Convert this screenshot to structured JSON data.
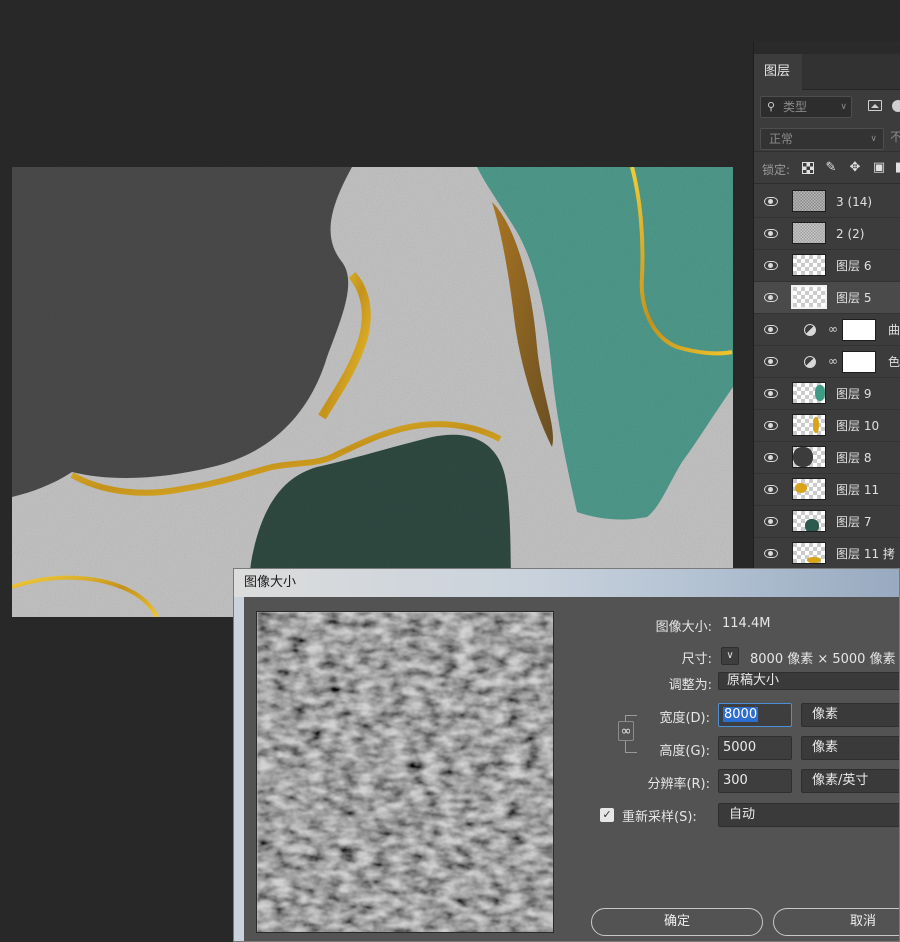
{
  "layers_panel": {
    "tab_label": "图层",
    "filter_placeholder": "类型",
    "blend_mode": "正常",
    "opacity_label": "不",
    "lock_label": "锁定:",
    "icons": {
      "search": "magnifier-icon",
      "lock_pixels": "checkerboard-icon",
      "lock_brush": "brush-icon",
      "lock_move": "move-icon",
      "lock_artboard": "crop-icon",
      "eye": "eye-icon",
      "adjustment": "half-circle-icon",
      "link": "chain-link-icon"
    },
    "layers": [
      {
        "name": "3 (14)",
        "thumb": "texture"
      },
      {
        "name": "2 (2)",
        "thumb": "texture"
      },
      {
        "name": "图层 6",
        "thumb": "transparent"
      },
      {
        "name": "图层 5",
        "thumb": "transparent",
        "selected": true
      },
      {
        "name": "曲",
        "type": "adjustment"
      },
      {
        "name": "色",
        "type": "adjustment"
      },
      {
        "name": "图层 9",
        "thumb": "teal"
      },
      {
        "name": "图层 10",
        "thumb": "gold"
      },
      {
        "name": "图层 8",
        "thumb": "dark"
      },
      {
        "name": "图层 11",
        "thumb": "gold2"
      },
      {
        "name": "图层 7",
        "thumb": "green"
      },
      {
        "name": "图层 11 拷",
        "thumb": "gold3"
      }
    ]
  },
  "dialog": {
    "title": "图像大小",
    "image_size_label": "图像大小:",
    "image_size_value": "114.4M",
    "dimensions_label": "尺寸:",
    "dimensions_value": "8000 像素  ×  5000 像素",
    "fit_to_label": "调整为:",
    "fit_to_value": "原稿大小",
    "width_label": "宽度(D):",
    "width_value": "8000",
    "width_unit": "像素",
    "height_label": "高度(G):",
    "height_value": "5000",
    "height_unit": "像素",
    "resolution_label": "分辨率(R):",
    "resolution_value": "300",
    "resolution_unit": "像素/英寸",
    "resample_label": "重新采样(S):",
    "resample_checked": true,
    "resample_value": "自动",
    "ok_button": "确定",
    "cancel_button": "取消"
  },
  "colors": {
    "app_background": "#282828",
    "panel_background": "#3c3c3c",
    "dialog_background": "#535353",
    "accent_blue": "#2d6fd0",
    "canvas_gray": "#c2c2c2",
    "canvas_charcoal": "#4a4a4a",
    "canvas_teal": "#4f9a8c",
    "canvas_dark_green": "#2f4a42",
    "canvas_gold": "#d4a21e"
  }
}
